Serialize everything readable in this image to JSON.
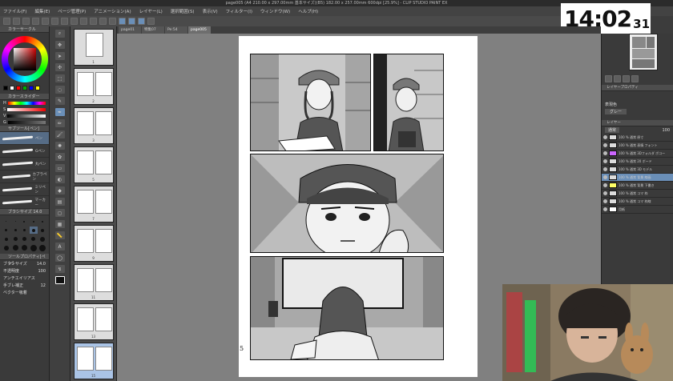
{
  "window": {
    "title": "page005 (A4 210.00 x 297.00mm 基本サイズ)(B5) 182.00 x 257.00mm 600dpi [25.9%] - CLIP STUDIO PAINT EX"
  },
  "menu": [
    "ファイル(F)",
    "編集(E)",
    "ページ管理(P)",
    "アニメーション(A)",
    "レイヤー(L)",
    "選択範囲(S)",
    "表示(V)",
    "フィルター(I)",
    "ウィンドウ(W)",
    "ヘルプ(H)"
  ],
  "clock": {
    "hm": "14:02",
    "ss": "31"
  },
  "tabs": [
    "page01",
    "特集07",
    "Pe:54",
    "page005"
  ],
  "left": {
    "color_panel_title": "カラーサークル",
    "slider_panel_title": "カラースライダー",
    "brush_panel_title": "サブツール[ペン]",
    "brushes": [
      "ペン",
      "Gペン",
      "丸ペン",
      "カブラペン",
      "ミリペン",
      "マーカー"
    ],
    "brushsize_panel_title": "ブラシサイズ",
    "brushsize_value": "14.0",
    "tool_property_title": "ツールプロパティ[ペン]",
    "brush_size_label": "ブラシサイズ",
    "brush_size_value": "14.0",
    "opacity_label": "不透明度",
    "opacity_value": "100",
    "aa_label": "アンチエイリアス",
    "correction_label": "手ブレ補正",
    "correction_value": "12",
    "vector_label": "ベクター吸着"
  },
  "sizes": [
    "1",
    "1.5",
    "2",
    "2.5",
    "3",
    "4",
    "5",
    "6",
    "7",
    "8",
    "10",
    "12",
    "15",
    "17",
    "20",
    "25",
    "30",
    "40",
    "50",
    "60"
  ],
  "pages": [
    {
      "num": "1",
      "selected": false
    },
    {
      "num": "2",
      "selected": false
    },
    {
      "num": "3",
      "selected": false
    },
    {
      "num": "5",
      "selected": false
    },
    {
      "num": "6",
      "selected": false
    },
    {
      "num": "7",
      "selected": false
    },
    {
      "num": "8",
      "selected": false
    },
    {
      "num": "9",
      "selected": false
    },
    {
      "num": "10",
      "selected": false
    },
    {
      "num": "11",
      "selected": false
    },
    {
      "num": "12",
      "selected": false
    },
    {
      "num": "13",
      "selected": false
    },
    {
      "num": "14",
      "selected": false
    },
    {
      "num": "15",
      "selected": true
    }
  ],
  "canvas": {
    "page_number": "5"
  },
  "right": {
    "property_title": "レイヤープロパティ",
    "display_color_label": "表現色",
    "display_color_value": "グレー",
    "layer_panel_title": "レイヤー",
    "blend_mode": "通常",
    "opacity": "100",
    "layers": [
      {
        "name": "100 % 通常 原寸",
        "selected": false
      },
      {
        "name": "100 % 通常 表情 フォント",
        "selected": false
      },
      {
        "name": "100 % 通常 3Dフォルダ ボコー",
        "selected": false
      },
      {
        "name": "100 % 通常 20 ボード",
        "selected": false
      },
      {
        "name": "100 % 通常 3D モデル",
        "selected": false
      },
      {
        "name": "100 % 通常 背景 線画",
        "selected": true
      },
      {
        "name": "100 % 通常 背景 下書き",
        "selected": false
      },
      {
        "name": "100 % 通常 コマ 枠",
        "selected": false
      },
      {
        "name": "100 % 通常 コマ 枠線",
        "selected": false
      },
      {
        "name": "用紙",
        "selected": false
      }
    ]
  }
}
